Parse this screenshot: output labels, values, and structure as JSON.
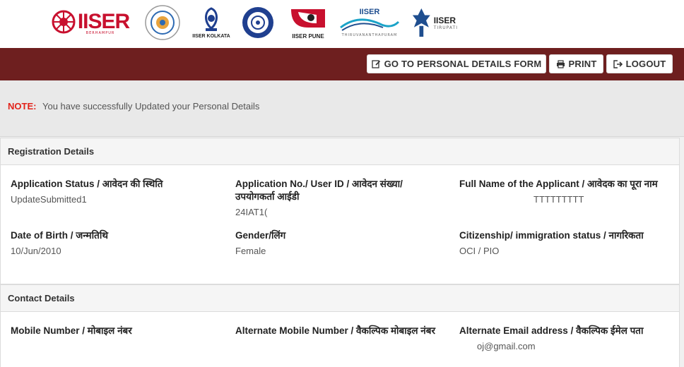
{
  "logos": [
    {
      "name": "IISER",
      "sub": "BERHAMPUR"
    },
    {
      "name": "",
      "sub": ""
    },
    {
      "name": "IISER KOLKATA",
      "sub": ""
    },
    {
      "name": "",
      "sub": ""
    },
    {
      "name": "IISER PUNE",
      "sub": ""
    },
    {
      "name": "IISER",
      "sub": "THIRUVANANTHAPURAM"
    },
    {
      "name": "IISER",
      "sub": "TIRUPATI"
    }
  ],
  "nav": {
    "personal_form": "GO TO PERSONAL DETAILS FORM",
    "print": "PRINT",
    "logout": "LOGOUT"
  },
  "note": {
    "label": "NOTE:",
    "text": "You have successfully Updated your Personal Details"
  },
  "registration": {
    "title": "Registration Details",
    "fields": [
      {
        "label": "Application Status / आवेदन की स्थिति",
        "value": "UpdateSubmitted1"
      },
      {
        "label": "Application No./ User ID / आवेदन संख्या/उपयोगकर्ता आईडी",
        "value": "24IAT1("
      },
      {
        "label": "Full Name of the Applicant / आवेदक का पूरा नाम",
        "value": "TTTTTTTTT"
      },
      {
        "label": "Date of Birth / जन्मतिथि",
        "value": "10/Jun/2010"
      },
      {
        "label": "Gender/लिंग",
        "value": "Female"
      },
      {
        "label": "Citizenship/ immigration status / नागरिकता",
        "value": "OCI / PIO"
      }
    ]
  },
  "contact": {
    "title": "Contact Details",
    "fields": [
      {
        "label": "Mobile Number / मोबाइल नंबर",
        "value": ""
      },
      {
        "label": "Alternate Mobile Number / वैकल्पिक मोबाइल नंबर",
        "value": ""
      },
      {
        "label": "Alternate Email address / वैकल्पिक ईमेल पता",
        "value": "oj@gmail.com"
      }
    ]
  },
  "colors": {
    "nav_bg": "#6e1f1f",
    "note_red": "#e2231a",
    "iiser_red": "#c8102e",
    "iiser_blue": "#1f3f8f"
  }
}
